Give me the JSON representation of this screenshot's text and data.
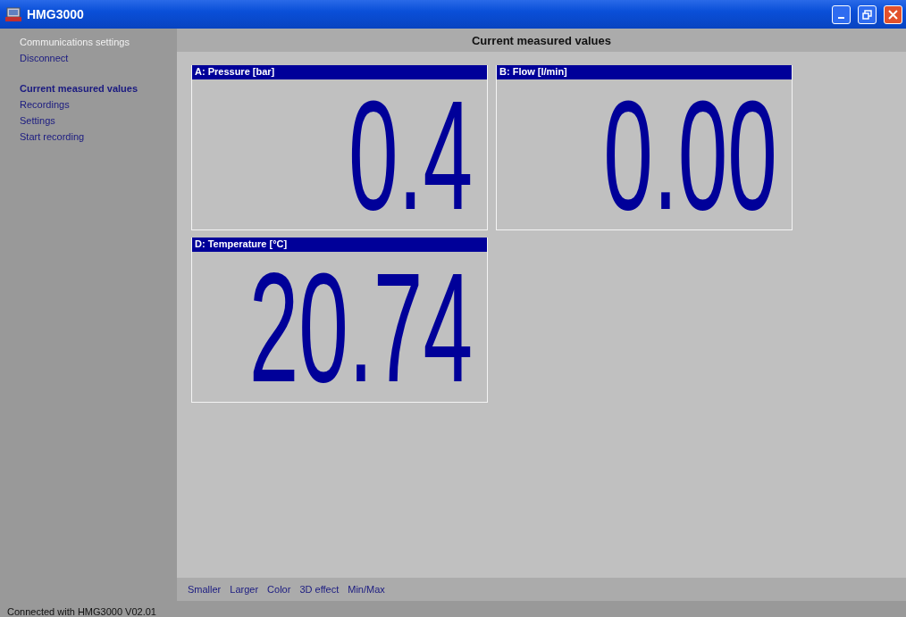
{
  "window": {
    "title": "HMG3000"
  },
  "sidebar": {
    "groups": [
      [
        {
          "label": "Communications settings",
          "selected": false,
          "disabled": true
        },
        {
          "label": "Disconnect",
          "selected": false,
          "disabled": false
        }
      ],
      [
        {
          "label": "Current measured values",
          "selected": true,
          "disabled": false
        },
        {
          "label": "Recordings",
          "selected": false,
          "disabled": false
        },
        {
          "label": "Settings",
          "selected": false,
          "disabled": false
        },
        {
          "label": "Start recording",
          "selected": false,
          "disabled": false
        }
      ]
    ]
  },
  "header": "Current measured values",
  "panels": [
    {
      "title": "A: Pressure [bar]",
      "reading": "0.4"
    },
    {
      "title": "B: Flow [l/min]",
      "reading": "0.00"
    },
    {
      "title": "D: Temperature [°C]",
      "reading": "20.74"
    }
  ],
  "toolbar": [
    "Smaller",
    "Larger",
    "Color",
    "3D effect",
    "Min/Max"
  ],
  "status_bar": "Connected with HMG3000 V02.01"
}
